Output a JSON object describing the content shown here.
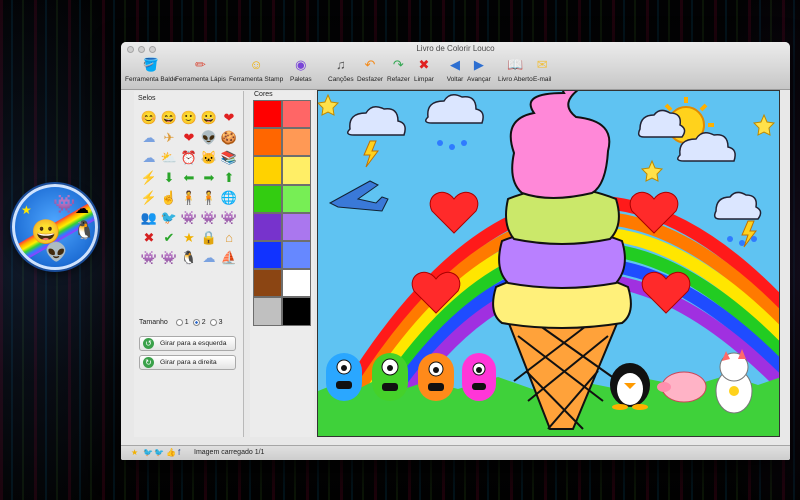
{
  "window": {
    "title": "Livro de Colorir Louco"
  },
  "toolbar": {
    "items": [
      {
        "label": "Ferramenta Balde",
        "icon": "bucket-icon",
        "glyph": "🪣"
      },
      {
        "label": "Ferramenta Lápis",
        "icon": "pencils-icon",
        "glyph": "✏"
      },
      {
        "label": "Ferramenta Stamp",
        "icon": "stamp-smiley-icon",
        "glyph": "☺"
      },
      {
        "label": "Paletas",
        "icon": "palette-icon",
        "glyph": "◉"
      },
      {
        "label": "Canções",
        "icon": "music-note-icon",
        "glyph": "♫"
      },
      {
        "label": "Desfazer",
        "icon": "undo-icon",
        "glyph": "↶"
      },
      {
        "label": "Refazer",
        "icon": "redo-icon",
        "glyph": "↷"
      },
      {
        "label": "Limpar",
        "icon": "clear-x-icon",
        "glyph": "✖"
      },
      {
        "label": "Voltar",
        "icon": "back-arrow-icon",
        "glyph": "◀"
      },
      {
        "label": "Avançar",
        "icon": "forward-arrow-icon",
        "glyph": "▶"
      },
      {
        "label": "Livro Aberto",
        "icon": "open-book-icon",
        "glyph": "📖"
      },
      {
        "label": "E-mail",
        "icon": "email-icon",
        "glyph": "✉"
      }
    ]
  },
  "stamps": {
    "label": "Selos",
    "items": [
      {
        "icon": "smiley-icon",
        "glyph": "😊"
      },
      {
        "icon": "smiley-icon",
        "glyph": "😄"
      },
      {
        "icon": "smiley-icon",
        "glyph": "🙂"
      },
      {
        "icon": "smiley-icon",
        "glyph": "😀"
      },
      {
        "icon": "heart-icon",
        "glyph": "❤"
      },
      {
        "icon": "cloud-rain-icon",
        "glyph": "☁"
      },
      {
        "icon": "airplane-icon",
        "glyph": "✈"
      },
      {
        "icon": "heart-icon",
        "glyph": "❤"
      },
      {
        "icon": "alien-icon",
        "glyph": "👽"
      },
      {
        "icon": "cookie-icon",
        "glyph": "🍪"
      },
      {
        "icon": "cloud-icon",
        "glyph": "☁"
      },
      {
        "icon": "cloud-sun-icon",
        "glyph": "⛅"
      },
      {
        "icon": "alarm-clock-icon",
        "glyph": "⏰"
      },
      {
        "icon": "cat-icon",
        "glyph": "🐱"
      },
      {
        "icon": "books-icon",
        "glyph": "📚"
      },
      {
        "icon": "lightning-icon",
        "glyph": "⚡"
      },
      {
        "icon": "arrow-down-icon",
        "glyph": "⬇"
      },
      {
        "icon": "arrow-left-icon",
        "glyph": "⬅"
      },
      {
        "icon": "arrow-right-icon",
        "glyph": "➡"
      },
      {
        "icon": "arrow-up-icon",
        "glyph": "⬆"
      },
      {
        "icon": "lightning-icon",
        "glyph": "⚡"
      },
      {
        "icon": "hand-icon",
        "glyph": "☝"
      },
      {
        "icon": "person-icon",
        "glyph": "🧍"
      },
      {
        "icon": "person-icon",
        "glyph": "🧍"
      },
      {
        "icon": "globe-icon",
        "glyph": "🌐"
      },
      {
        "icon": "people-icon",
        "glyph": "👥"
      },
      {
        "icon": "bird-icon",
        "glyph": "🐦"
      },
      {
        "icon": "monster-icon",
        "glyph": "👾"
      },
      {
        "icon": "monster-icon",
        "glyph": "👾"
      },
      {
        "icon": "monster-icon",
        "glyph": "👾"
      },
      {
        "icon": "red-x-icon",
        "glyph": "✖"
      },
      {
        "icon": "check-icon",
        "glyph": "✔"
      },
      {
        "icon": "star-icon",
        "glyph": "★"
      },
      {
        "icon": "lock-icon",
        "glyph": "🔒"
      },
      {
        "icon": "house-icon",
        "glyph": "⌂"
      },
      {
        "icon": "monster-icon",
        "glyph": "👾"
      },
      {
        "icon": "monster-icon",
        "glyph": "👾"
      },
      {
        "icon": "penguin-icon",
        "glyph": "🐧"
      },
      {
        "icon": "cloud-icon",
        "glyph": "☁"
      },
      {
        "icon": "sailboat-icon",
        "glyph": "⛵"
      }
    ],
    "size_label": "Tamanho",
    "sizes": [
      "1",
      "2",
      "3"
    ],
    "selected_size": "2",
    "rotate_left": "Girar para a esquerda",
    "rotate_right": "Girar para a direita"
  },
  "colors": {
    "label": "Cores",
    "swatches": [
      "#ff0000",
      "#ff6666",
      "#ff6600",
      "#ff9955",
      "#ffd200",
      "#ffee66",
      "#33cc11",
      "#77ee55",
      "#7733cc",
      "#aa77ee",
      "#1133ff",
      "#6688ff",
      "#8b4513",
      "#ffffff",
      "#c0c0c0",
      "#000000"
    ]
  },
  "status": {
    "text": "Imagem carregado 1/1"
  }
}
